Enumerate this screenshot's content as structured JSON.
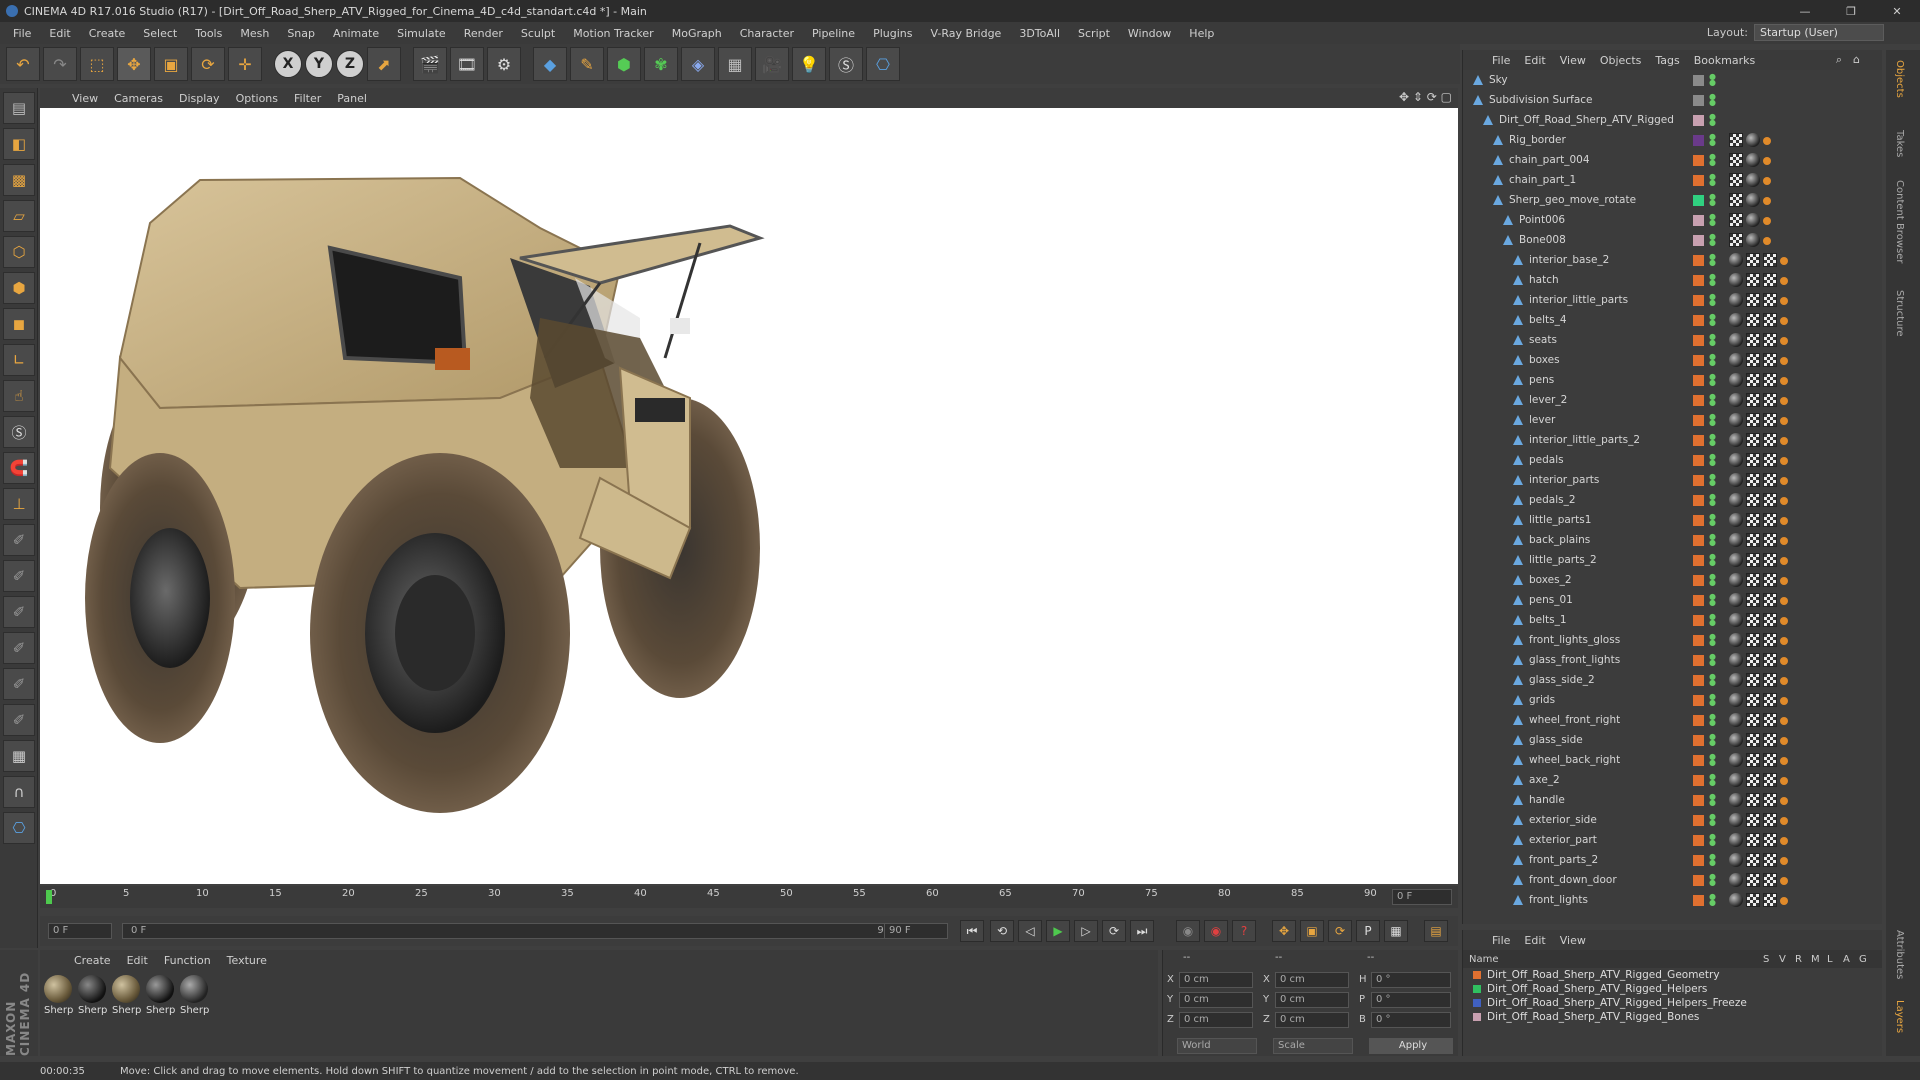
{
  "window": {
    "title": "CINEMA 4D R17.016 Studio (R17) - [Dirt_Off_Road_Sherp_ATV_Rigged_for_Cinema_4D_c4d_standart.c4d *] - Main",
    "minimize": "—",
    "maximize": "❐",
    "close": "✕"
  },
  "menu": [
    "File",
    "Edit",
    "Create",
    "Select",
    "Tools",
    "Mesh",
    "Snap",
    "Animate",
    "Simulate",
    "Render",
    "Sculpt",
    "Motion Tracker",
    "MoGraph",
    "Character",
    "Pipeline",
    "Plugins",
    "V-Ray Bridge",
    "3DToAll",
    "Script",
    "Window",
    "Help"
  ],
  "layout": {
    "label": "Layout:",
    "value": "Startup (User)"
  },
  "viewport_menu": [
    "View",
    "Cameras",
    "Display",
    "Options",
    "Filter",
    "Panel"
  ],
  "timeline": {
    "ticks": [
      "0",
      "5",
      "10",
      "15",
      "20",
      "25",
      "30",
      "35",
      "40",
      "45",
      "50",
      "55",
      "60",
      "65",
      "70",
      "75",
      "80",
      "85",
      "90"
    ],
    "current_frame": "0 F",
    "start": "0 F",
    "range_start": "0 F",
    "range_end": "90 F",
    "end": "90 F"
  },
  "material_menu": [
    "Create",
    "Edit",
    "Function",
    "Texture"
  ],
  "materials": [
    "Sherp",
    "Sherp",
    "Sherp",
    "Sherp",
    "Sherp"
  ],
  "coords": {
    "header": [
      "--",
      "--",
      "--"
    ],
    "rows": [
      {
        "a": "X",
        "av": "0 cm",
        "b": "X",
        "bv": "0 cm",
        "c": "H",
        "cv": "0 °"
      },
      {
        "a": "Y",
        "av": "0 cm",
        "b": "Y",
        "bv": "0 cm",
        "c": "P",
        "cv": "0 °"
      },
      {
        "a": "Z",
        "av": "0 cm",
        "b": "Z",
        "bv": "0 cm",
        "c": "B",
        "cv": "0 °"
      }
    ],
    "world": "World",
    "scale": "Scale",
    "apply": "Apply"
  },
  "status": {
    "time": "00:00:35",
    "message": "Move: Click and drag to move elements. Hold down SHIFT to quantize movement / add to the selection in point mode, CTRL to remove."
  },
  "maxon": "MAXON CINEMA 4D",
  "object_menu": [
    "File",
    "Edit",
    "View",
    "Objects",
    "Tags",
    "Bookmarks"
  ],
  "objects": [
    {
      "name": "Sky",
      "indent": 0,
      "color": "#8a8a8a"
    },
    {
      "name": "Subdivision Surface",
      "indent": 0,
      "color": "#8a8a8a"
    },
    {
      "name": "Dirt_Off_Road_Sherp_ATV_Rigged",
      "indent": 1,
      "color": "#c8a0b0"
    },
    {
      "name": "Rig_border",
      "indent": 2,
      "color": "#6a3a8a"
    },
    {
      "name": "chain_part_004",
      "indent": 2,
      "color": "#e07030"
    },
    {
      "name": "chain_part_1",
      "indent": 2,
      "color": "#e07030"
    },
    {
      "name": "Sherp_geo_move_rotate",
      "indent": 2,
      "color": "#30d080"
    },
    {
      "name": "Point006",
      "indent": 3,
      "color": "#c8a0b0"
    },
    {
      "name": "Bone008",
      "indent": 3,
      "color": "#c8a0b0"
    },
    {
      "name": "interior_base_2",
      "indent": 4,
      "color": "#e07030"
    },
    {
      "name": "hatch",
      "indent": 4,
      "color": "#e07030"
    },
    {
      "name": "interior_little_parts",
      "indent": 4,
      "color": "#e07030"
    },
    {
      "name": "belts_4",
      "indent": 4,
      "color": "#e07030"
    },
    {
      "name": "seats",
      "indent": 4,
      "color": "#e07030"
    },
    {
      "name": "boxes",
      "indent": 4,
      "color": "#e07030"
    },
    {
      "name": "pens",
      "indent": 4,
      "color": "#e07030"
    },
    {
      "name": "lever_2",
      "indent": 4,
      "color": "#e07030"
    },
    {
      "name": "lever",
      "indent": 4,
      "color": "#e07030"
    },
    {
      "name": "interior_little_parts_2",
      "indent": 4,
      "color": "#e07030"
    },
    {
      "name": "pedals",
      "indent": 4,
      "color": "#e07030"
    },
    {
      "name": "interior_parts",
      "indent": 4,
      "color": "#e07030"
    },
    {
      "name": "pedals_2",
      "indent": 4,
      "color": "#e07030"
    },
    {
      "name": "little_parts1",
      "indent": 4,
      "color": "#e07030"
    },
    {
      "name": "back_plains",
      "indent": 4,
      "color": "#e07030"
    },
    {
      "name": "little_parts_2",
      "indent": 4,
      "color": "#e07030"
    },
    {
      "name": "boxes_2",
      "indent": 4,
      "color": "#e07030"
    },
    {
      "name": "pens_01",
      "indent": 4,
      "color": "#e07030"
    },
    {
      "name": "belts_1",
      "indent": 4,
      "color": "#e07030"
    },
    {
      "name": "front_lights_gloss",
      "indent": 4,
      "color": "#e07030"
    },
    {
      "name": "glass_front_lights",
      "indent": 4,
      "color": "#e07030"
    },
    {
      "name": "glass_side_2",
      "indent": 4,
      "color": "#e07030"
    },
    {
      "name": "grids",
      "indent": 4,
      "color": "#e07030"
    },
    {
      "name": "wheel_front_right",
      "indent": 4,
      "color": "#e07030"
    },
    {
      "name": "glass_side",
      "indent": 4,
      "color": "#e07030"
    },
    {
      "name": "wheel_back_right",
      "indent": 4,
      "color": "#e07030"
    },
    {
      "name": "axe_2",
      "indent": 4,
      "color": "#e07030"
    },
    {
      "name": "handle",
      "indent": 4,
      "color": "#e07030"
    },
    {
      "name": "exterior_side",
      "indent": 4,
      "color": "#e07030"
    },
    {
      "name": "exterior_part",
      "indent": 4,
      "color": "#e07030"
    },
    {
      "name": "front_parts_2",
      "indent": 4,
      "color": "#e07030"
    },
    {
      "name": "front_down_door",
      "indent": 4,
      "color": "#e07030"
    },
    {
      "name": "front_lights",
      "indent": 4,
      "color": "#e07030"
    }
  ],
  "layer_menu": [
    "File",
    "Edit",
    "View"
  ],
  "layer_columns": [
    "Name",
    "S",
    "V",
    "R",
    "M",
    "L",
    "A",
    "G"
  ],
  "layers": [
    {
      "name": "Dirt_Off_Road_Sherp_ATV_Rigged_Geometry",
      "color": "#e07030"
    },
    {
      "name": "Dirt_Off_Road_Sherp_ATV_Rigged_Helpers",
      "color": "#30c060"
    },
    {
      "name": "Dirt_Off_Road_Sherp_ATV_Rigged_Helpers_Freeze",
      "color": "#4060c0"
    },
    {
      "name": "Dirt_Off_Road_Sherp_ATV_Rigged_Bones",
      "color": "#c8a0b0"
    }
  ],
  "side_tabs": [
    "Objects",
    "Takes",
    "Content Browser",
    "Structure",
    "Attributes",
    "Layers"
  ]
}
